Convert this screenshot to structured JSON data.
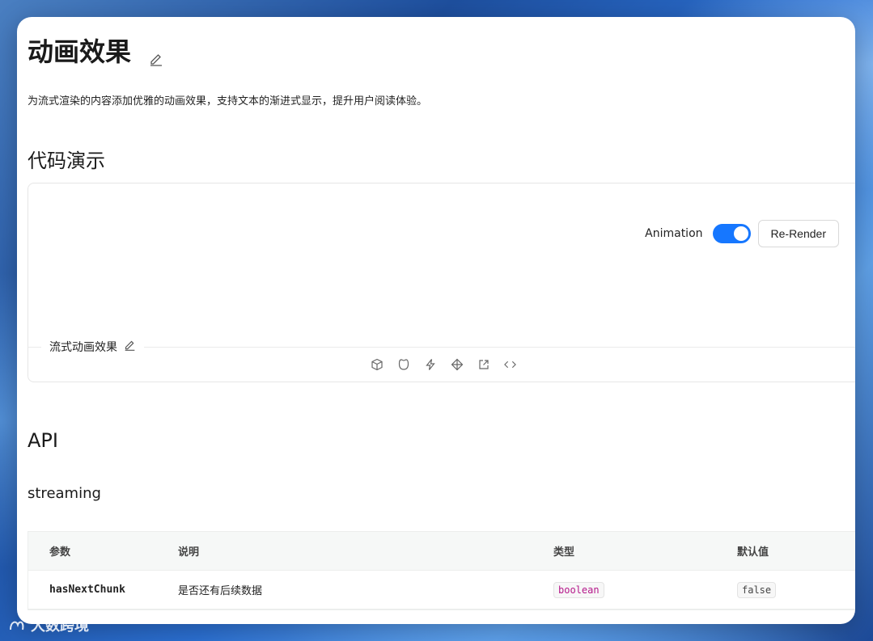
{
  "page": {
    "title": "动画效果",
    "description": "为流式渲染的内容添加优雅的动画效果，支持文本的渐进式显示，提升用户阅读体验。"
  },
  "demo": {
    "section_title": "代码演示",
    "animation_label": "Animation",
    "animation_enabled": true,
    "rerender_label": "Re-Render",
    "caption": "流式动画效果",
    "actions": [
      "codesandbox-icon",
      "codepen-icon",
      "stackblitz-icon",
      "code-sandbox-alt-icon",
      "external-link-icon",
      "code-icon"
    ]
  },
  "api": {
    "title": "API",
    "subtitle": "streaming",
    "columns": [
      "参数",
      "说明",
      "类型",
      "默认值"
    ],
    "rows": [
      {
        "param": "hasNextChunk",
        "desc": "是否还有后续数据",
        "type": "boolean",
        "default": "false"
      }
    ]
  },
  "watermark": "大数跨境",
  "colors": {
    "accent": "#1677ff",
    "type_tag": "#b5178a"
  }
}
